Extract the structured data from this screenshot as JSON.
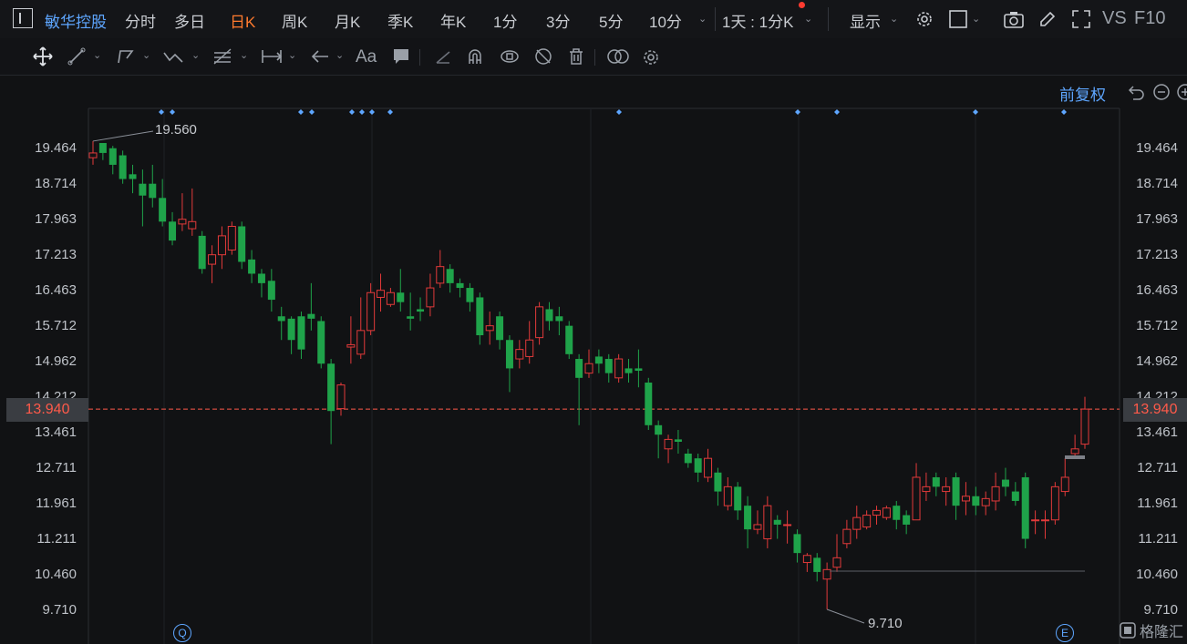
{
  "header": {
    "ticker": "敏华控股",
    "periods": [
      {
        "label": "分时",
        "active": false
      },
      {
        "label": "多日",
        "active": false
      },
      {
        "label": "日K",
        "active": true
      },
      {
        "label": "周K",
        "active": false
      },
      {
        "label": "月K",
        "active": false
      },
      {
        "label": "季K",
        "active": false
      },
      {
        "label": "年K",
        "active": false
      },
      {
        "label": "1分",
        "active": false
      },
      {
        "label": "3分",
        "active": false
      },
      {
        "label": "5分",
        "active": false
      },
      {
        "label": "10分",
        "active": false
      }
    ],
    "interval_select": "1天 : 1分K",
    "display_label": "显示",
    "vs_label": "VS",
    "f10_label": "F10"
  },
  "toolbar": {
    "tools": [
      "move-icon",
      "line-tool-icon",
      "polyline-tool-icon",
      "wave-tool-icon",
      "fib-tool-icon",
      "range-tool-icon",
      "arrow-tool-icon",
      "text-tool-icon",
      "comment-tool-icon",
      "pen-icon",
      "magnet-icon",
      "eye-lock-icon",
      "hide-icon",
      "trash-icon",
      "compare-icon",
      "settings-icon"
    ],
    "text_tool": "Aa"
  },
  "chart": {
    "adjust_label": "前复权",
    "current_price": "13.940",
    "max_label": "19.560",
    "min_label": "9.710",
    "q_marker": "Q",
    "e_marker": "E",
    "watermark": "格隆汇",
    "colors": {
      "up": "#e23a3a",
      "down": "#1fa34a",
      "accent": "#5ea6ff",
      "price": "#ff5a4a"
    }
  },
  "chart_data": {
    "type": "candlestick",
    "y_ticks": [
      "19.464",
      "18.714",
      "17.963",
      "17.213",
      "16.463",
      "15.712",
      "14.962",
      "14.212",
      "13.461",
      "12.711",
      "11.961",
      "11.211",
      "10.460",
      "9.710"
    ],
    "ylim": [
      9.71,
      19.464
    ],
    "candles": [
      {
        "o": 19.25,
        "c": 19.35,
        "h": 19.6,
        "l": 19.1
      },
      {
        "o": 19.56,
        "c": 19.35,
        "h": 19.56,
        "l": 19.2
      },
      {
        "o": 19.45,
        "c": 19.1,
        "h": 19.5,
        "l": 18.9
      },
      {
        "o": 19.3,
        "c": 18.8,
        "h": 19.4,
        "l": 18.7
      },
      {
        "o": 18.9,
        "c": 18.8,
        "h": 19.1,
        "l": 18.5
      },
      {
        "o": 18.7,
        "c": 18.45,
        "h": 19.0,
        "l": 17.8
      },
      {
        "o": 18.7,
        "c": 18.4,
        "h": 19.1,
        "l": 18.2
      },
      {
        "o": 18.4,
        "c": 17.9,
        "h": 18.8,
        "l": 17.8
      },
      {
        "o": 17.9,
        "c": 17.5,
        "h": 18.1,
        "l": 17.4
      },
      {
        "o": 17.85,
        "c": 17.95,
        "h": 18.5,
        "l": 17.7
      },
      {
        "o": 17.75,
        "c": 17.9,
        "h": 18.6,
        "l": 17.6
      },
      {
        "o": 17.6,
        "c": 16.9,
        "h": 17.7,
        "l": 16.8
      },
      {
        "o": 17.0,
        "c": 17.2,
        "h": 17.4,
        "l": 16.6
      },
      {
        "o": 17.2,
        "c": 17.6,
        "h": 17.8,
        "l": 16.9
      },
      {
        "o": 17.3,
        "c": 17.8,
        "h": 17.9,
        "l": 17.2
      },
      {
        "o": 17.8,
        "c": 17.05,
        "h": 17.9,
        "l": 16.9
      },
      {
        "o": 17.1,
        "c": 16.8,
        "h": 17.3,
        "l": 16.6
      },
      {
        "o": 16.8,
        "c": 16.6,
        "h": 16.9,
        "l": 16.3
      },
      {
        "o": 16.65,
        "c": 16.25,
        "h": 16.9,
        "l": 16.0
      },
      {
        "o": 15.9,
        "c": 15.8,
        "h": 16.1,
        "l": 15.4
      },
      {
        "o": 15.85,
        "c": 15.4,
        "h": 15.9,
        "l": 15.1
      },
      {
        "o": 15.9,
        "c": 15.2,
        "h": 16.0,
        "l": 15.0
      },
      {
        "o": 15.95,
        "c": 15.85,
        "h": 16.6,
        "l": 15.6
      },
      {
        "o": 15.8,
        "c": 14.9,
        "h": 15.9,
        "l": 14.8
      },
      {
        "o": 14.9,
        "c": 13.9,
        "h": 15.0,
        "l": 13.2
      },
      {
        "o": 13.95,
        "c": 14.45,
        "h": 14.5,
        "l": 13.8
      },
      {
        "o": 15.25,
        "c": 15.3,
        "h": 15.9,
        "l": 14.9
      },
      {
        "o": 15.1,
        "c": 15.6,
        "h": 16.3,
        "l": 15.0
      },
      {
        "o": 15.6,
        "c": 16.4,
        "h": 16.6,
        "l": 15.5
      },
      {
        "o": 16.3,
        "c": 16.45,
        "h": 16.8,
        "l": 16.0
      },
      {
        "o": 16.15,
        "c": 16.4,
        "h": 16.5,
        "l": 16.1
      },
      {
        "o": 16.4,
        "c": 16.2,
        "h": 16.9,
        "l": 16.0
      },
      {
        "o": 15.9,
        "c": 15.85,
        "h": 16.4,
        "l": 15.6
      },
      {
        "o": 16.05,
        "c": 16.0,
        "h": 16.3,
        "l": 15.8
      },
      {
        "o": 16.1,
        "c": 16.5,
        "h": 16.8,
        "l": 15.9
      },
      {
        "o": 16.6,
        "c": 16.95,
        "h": 17.3,
        "l": 16.5
      },
      {
        "o": 16.9,
        "c": 16.6,
        "h": 17.0,
        "l": 16.4
      },
      {
        "o": 16.6,
        "c": 16.5,
        "h": 16.7,
        "l": 16.3
      },
      {
        "o": 16.5,
        "c": 16.2,
        "h": 16.6,
        "l": 16.0
      },
      {
        "o": 16.3,
        "c": 15.5,
        "h": 16.4,
        "l": 15.3
      },
      {
        "o": 15.6,
        "c": 15.7,
        "h": 16.0,
        "l": 15.3
      },
      {
        "o": 15.9,
        "c": 15.4,
        "h": 16.0,
        "l": 15.2
      },
      {
        "o": 15.4,
        "c": 14.8,
        "h": 15.5,
        "l": 14.3
      },
      {
        "o": 15.0,
        "c": 15.2,
        "h": 15.4,
        "l": 14.8
      },
      {
        "o": 15.05,
        "c": 15.4,
        "h": 15.8,
        "l": 14.9
      },
      {
        "o": 15.45,
        "c": 16.1,
        "h": 16.2,
        "l": 15.3
      },
      {
        "o": 16.05,
        "c": 15.8,
        "h": 16.2,
        "l": 15.6
      },
      {
        "o": 15.9,
        "c": 15.8,
        "h": 16.1,
        "l": 15.5
      },
      {
        "o": 15.7,
        "c": 15.1,
        "h": 15.8,
        "l": 15.0
      },
      {
        "o": 15.0,
        "c": 14.6,
        "h": 15.1,
        "l": 13.6
      },
      {
        "o": 14.7,
        "c": 14.9,
        "h": 15.2,
        "l": 14.6
      },
      {
        "o": 15.05,
        "c": 14.9,
        "h": 15.2,
        "l": 14.7
      },
      {
        "o": 15.0,
        "c": 14.7,
        "h": 15.1,
        "l": 14.5
      },
      {
        "o": 14.6,
        "c": 15.0,
        "h": 15.1,
        "l": 14.5
      },
      {
        "o": 14.8,
        "c": 14.7,
        "h": 15.0,
        "l": 14.5
      },
      {
        "o": 14.8,
        "c": 14.75,
        "h": 15.2,
        "l": 14.4
      },
      {
        "o": 14.5,
        "c": 13.6,
        "h": 14.6,
        "l": 13.5
      },
      {
        "o": 13.6,
        "c": 13.4,
        "h": 13.7,
        "l": 12.9
      },
      {
        "o": 13.1,
        "c": 13.3,
        "h": 13.4,
        "l": 12.8
      },
      {
        "o": 13.3,
        "c": 13.25,
        "h": 13.5,
        "l": 13.0
      },
      {
        "o": 13.0,
        "c": 12.8,
        "h": 13.1,
        "l": 12.7
      },
      {
        "o": 12.9,
        "c": 12.6,
        "h": 13.0,
        "l": 12.4
      },
      {
        "o": 12.5,
        "c": 12.9,
        "h": 13.1,
        "l": 12.4
      },
      {
        "o": 12.6,
        "c": 12.2,
        "h": 12.7,
        "l": 11.9
      },
      {
        "o": 11.9,
        "c": 12.3,
        "h": 12.5,
        "l": 11.8
      },
      {
        "o": 12.3,
        "c": 11.8,
        "h": 12.4,
        "l": 11.6
      },
      {
        "o": 11.9,
        "c": 11.4,
        "h": 12.1,
        "l": 11.0
      },
      {
        "o": 11.4,
        "c": 11.5,
        "h": 11.8,
        "l": 11.3
      },
      {
        "o": 11.2,
        "c": 11.9,
        "h": 12.1,
        "l": 11.0
      },
      {
        "o": 11.6,
        "c": 11.5,
        "h": 11.7,
        "l": 11.2
      },
      {
        "o": 11.5,
        "c": 11.5,
        "h": 11.8,
        "l": 11.1
      },
      {
        "o": 11.3,
        "c": 10.9,
        "h": 11.4,
        "l": 10.7
      },
      {
        "o": 10.7,
        "c": 10.85,
        "h": 10.9,
        "l": 10.5
      },
      {
        "o": 10.8,
        "c": 10.5,
        "h": 10.9,
        "l": 10.3
      },
      {
        "o": 10.35,
        "c": 10.55,
        "h": 10.7,
        "l": 9.71
      },
      {
        "o": 10.6,
        "c": 10.8,
        "h": 11.3,
        "l": 10.5
      },
      {
        "o": 11.1,
        "c": 11.4,
        "h": 11.6,
        "l": 11.0
      },
      {
        "o": 11.4,
        "c": 11.65,
        "h": 11.9,
        "l": 11.2
      },
      {
        "o": 11.45,
        "c": 11.7,
        "h": 11.8,
        "l": 11.4
      },
      {
        "o": 11.7,
        "c": 11.8,
        "h": 11.9,
        "l": 11.5
      },
      {
        "o": 11.65,
        "c": 11.85,
        "h": 11.9,
        "l": 11.6
      },
      {
        "o": 11.9,
        "c": 11.6,
        "h": 12.0,
        "l": 11.4
      },
      {
        "o": 11.7,
        "c": 11.5,
        "h": 11.8,
        "l": 11.3
      },
      {
        "o": 11.6,
        "c": 12.5,
        "h": 12.8,
        "l": 11.6
      },
      {
        "o": 12.2,
        "c": 12.3,
        "h": 12.6,
        "l": 12.0
      },
      {
        "o": 12.5,
        "c": 12.3,
        "h": 12.6,
        "l": 12.1
      },
      {
        "o": 12.2,
        "c": 12.3,
        "h": 12.5,
        "l": 11.9
      },
      {
        "o": 12.5,
        "c": 11.9,
        "h": 12.6,
        "l": 11.6
      },
      {
        "o": 12.0,
        "c": 12.1,
        "h": 12.4,
        "l": 11.7
      },
      {
        "o": 12.1,
        "c": 11.9,
        "h": 12.3,
        "l": 11.7
      },
      {
        "o": 11.9,
        "c": 12.05,
        "h": 12.2,
        "l": 11.7
      },
      {
        "o": 12.0,
        "c": 12.3,
        "h": 12.6,
        "l": 11.8
      },
      {
        "o": 12.45,
        "c": 12.3,
        "h": 12.7,
        "l": 12.1
      },
      {
        "o": 12.2,
        "c": 12.0,
        "h": 12.4,
        "l": 11.9
      },
      {
        "o": 12.5,
        "c": 11.2,
        "h": 12.6,
        "l": 11.0
      },
      {
        "o": 11.6,
        "c": 11.6,
        "h": 11.8,
        "l": 11.3
      },
      {
        "o": 11.6,
        "c": 11.6,
        "h": 11.8,
        "l": 11.2
      },
      {
        "o": 11.6,
        "c": 12.3,
        "h": 12.4,
        "l": 11.5
      },
      {
        "o": 12.2,
        "c": 12.5,
        "h": 12.9,
        "l": 12.1
      },
      {
        "o": 13.0,
        "c": 13.1,
        "h": 13.4,
        "l": 12.9
      },
      {
        "o": 13.2,
        "c": 13.94,
        "h": 14.2,
        "l": 13.1
      }
    ]
  }
}
